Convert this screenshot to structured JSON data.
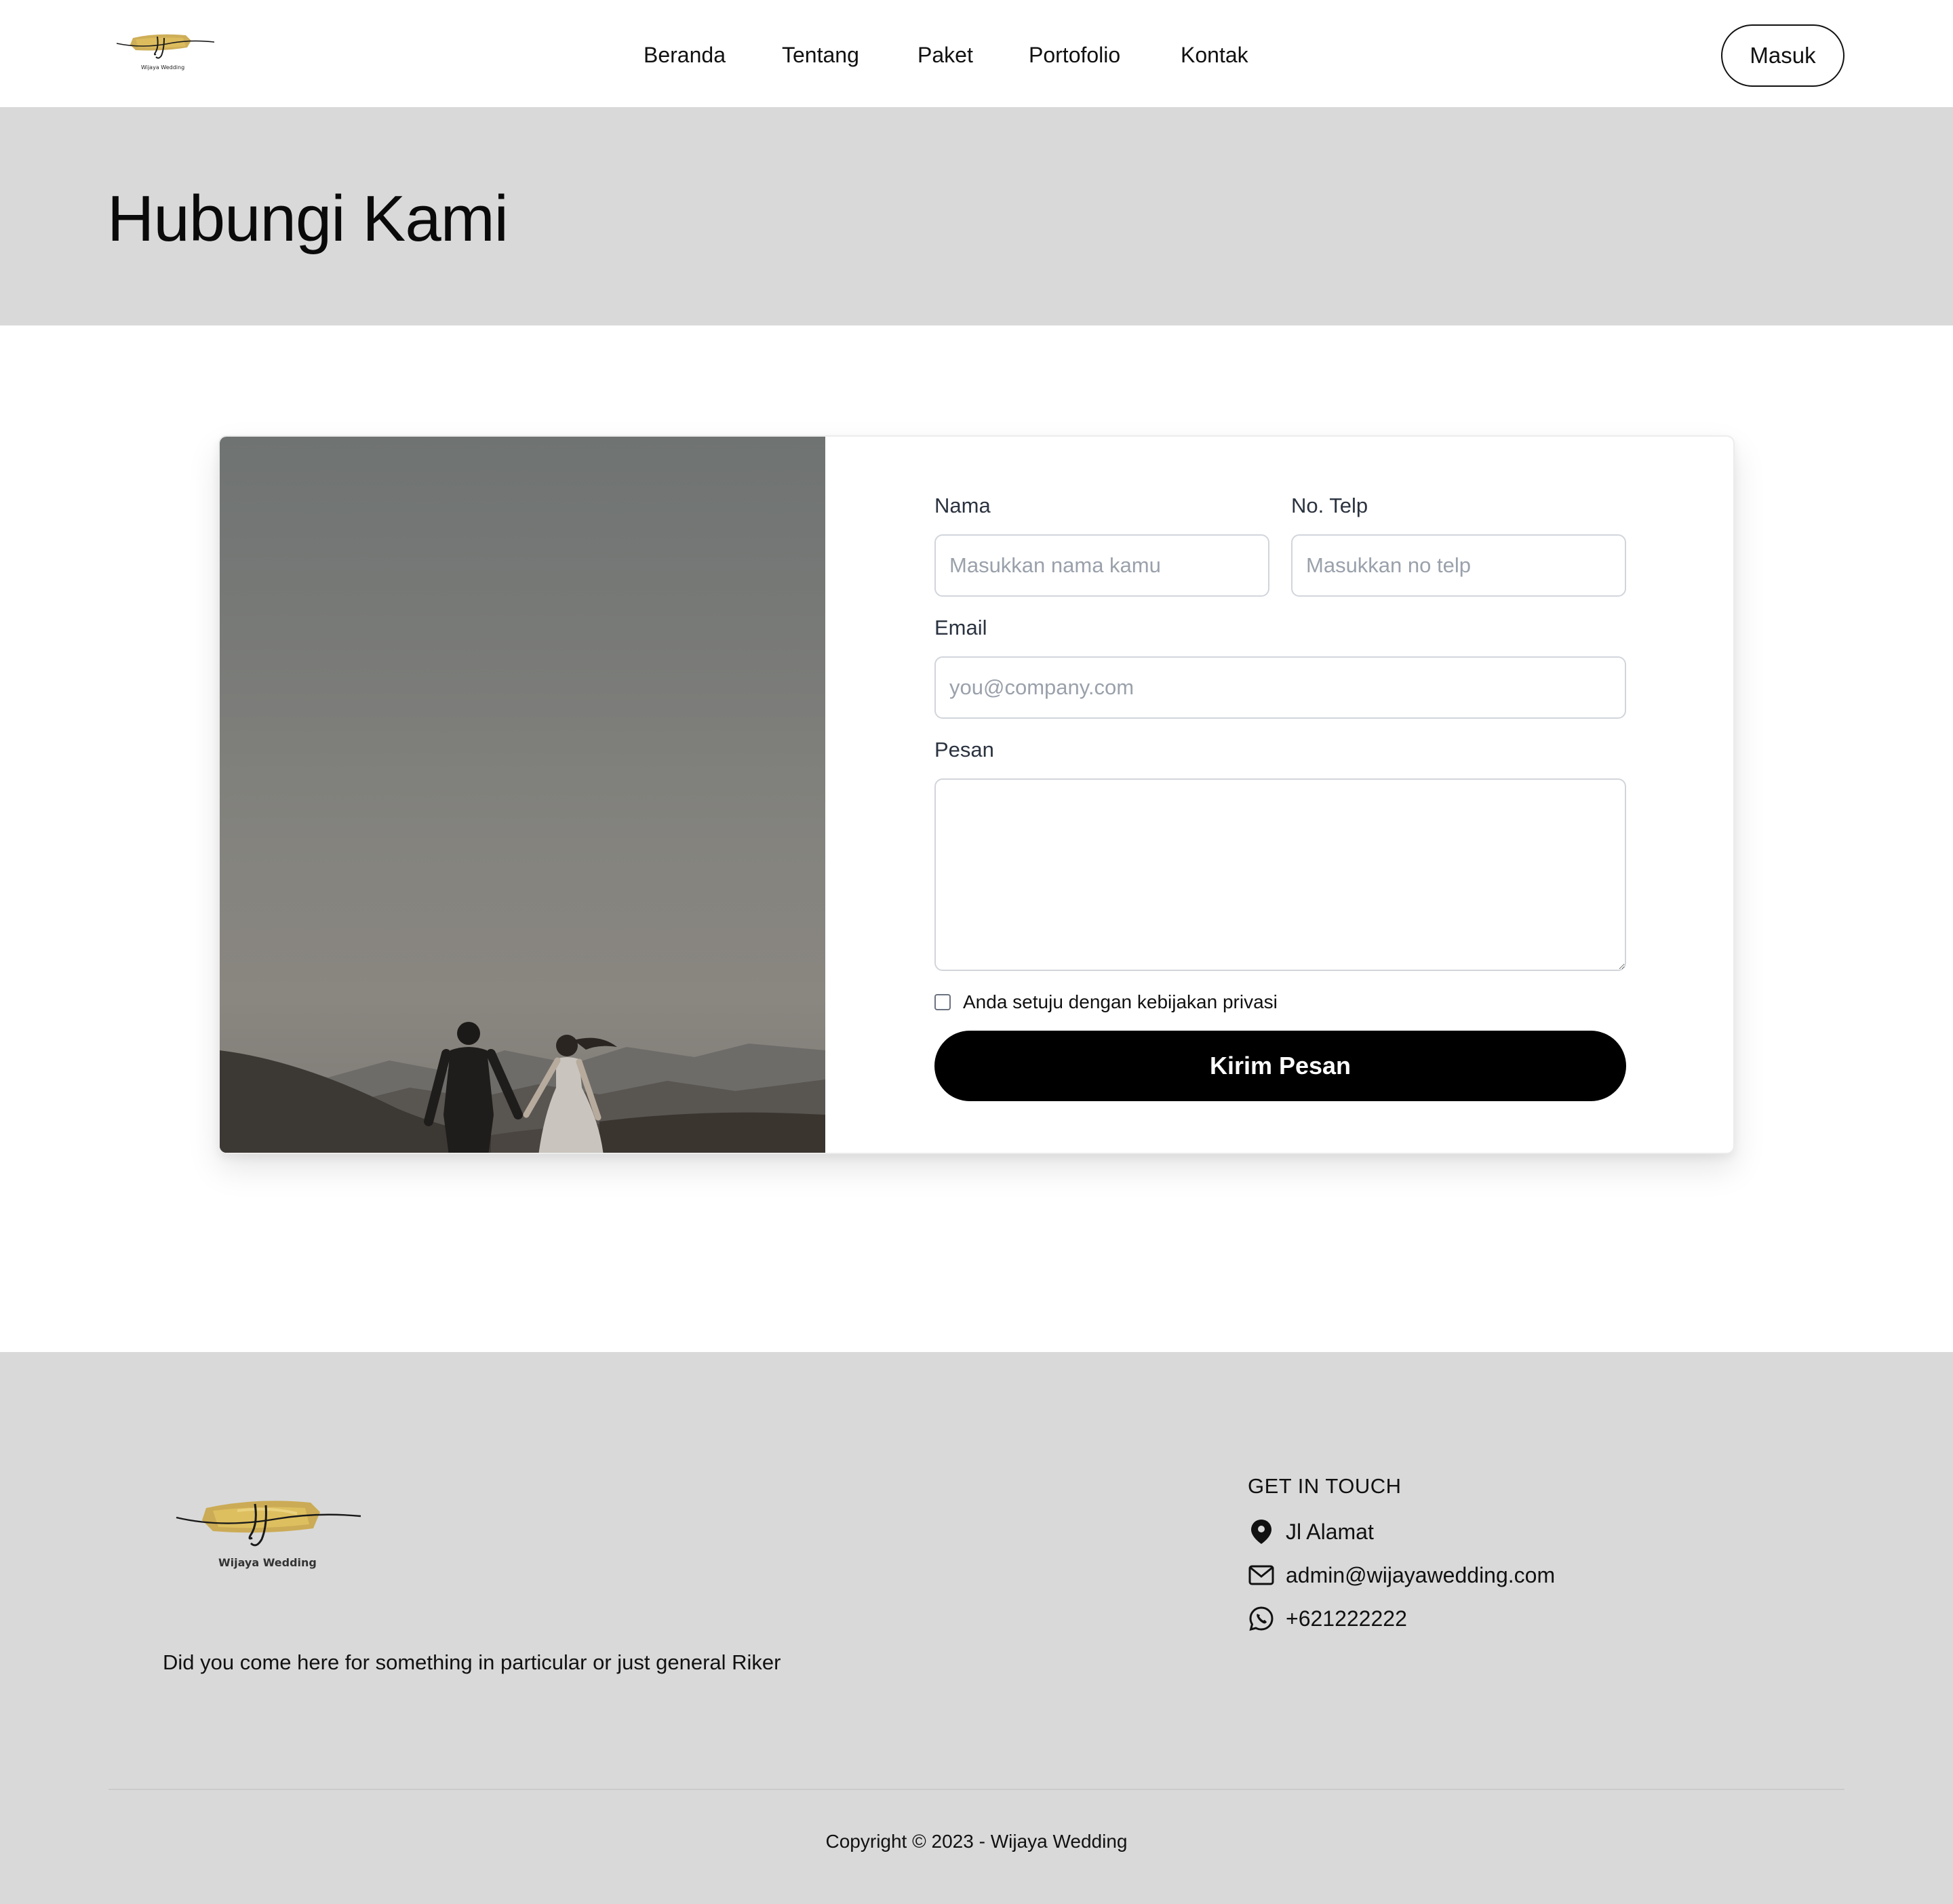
{
  "brand": {
    "logo_text": "Wijaya Wedding",
    "monogram": "wj",
    "logo_color": "#c9a546"
  },
  "nav": {
    "items": [
      {
        "label": "Beranda"
      },
      {
        "label": "Tentang"
      },
      {
        "label": "Paket"
      },
      {
        "label": "Portofolio"
      },
      {
        "label": "Kontak"
      }
    ],
    "login_label": "Masuk"
  },
  "banner": {
    "title": "Hubungi Kami",
    "background": "#d9d9d9"
  },
  "form": {
    "name_label": "Nama",
    "name_placeholder": "Masukkan nama kamu",
    "phone_label": "No. Telp",
    "phone_placeholder": "Masukkan no telp",
    "email_label": "Email",
    "email_placeholder": "you@company.com",
    "message_label": "Pesan",
    "privacy_label": "Anda setuju dengan kebijakan privasi",
    "submit_label": "Kirim Pesan"
  },
  "footer": {
    "description": "Did you come here for something in particular or just general Riker",
    "contact_heading": "GET IN TOUCH",
    "contacts": [
      {
        "icon": "map-pin-icon",
        "text": "Jl Alamat"
      },
      {
        "icon": "mail-icon",
        "text": "admin@wijayawedding.com"
      },
      {
        "icon": "whatsapp-icon",
        "text": "+621222222"
      }
    ],
    "copyright": "Copyright © 2023 - Wijaya Wedding"
  }
}
